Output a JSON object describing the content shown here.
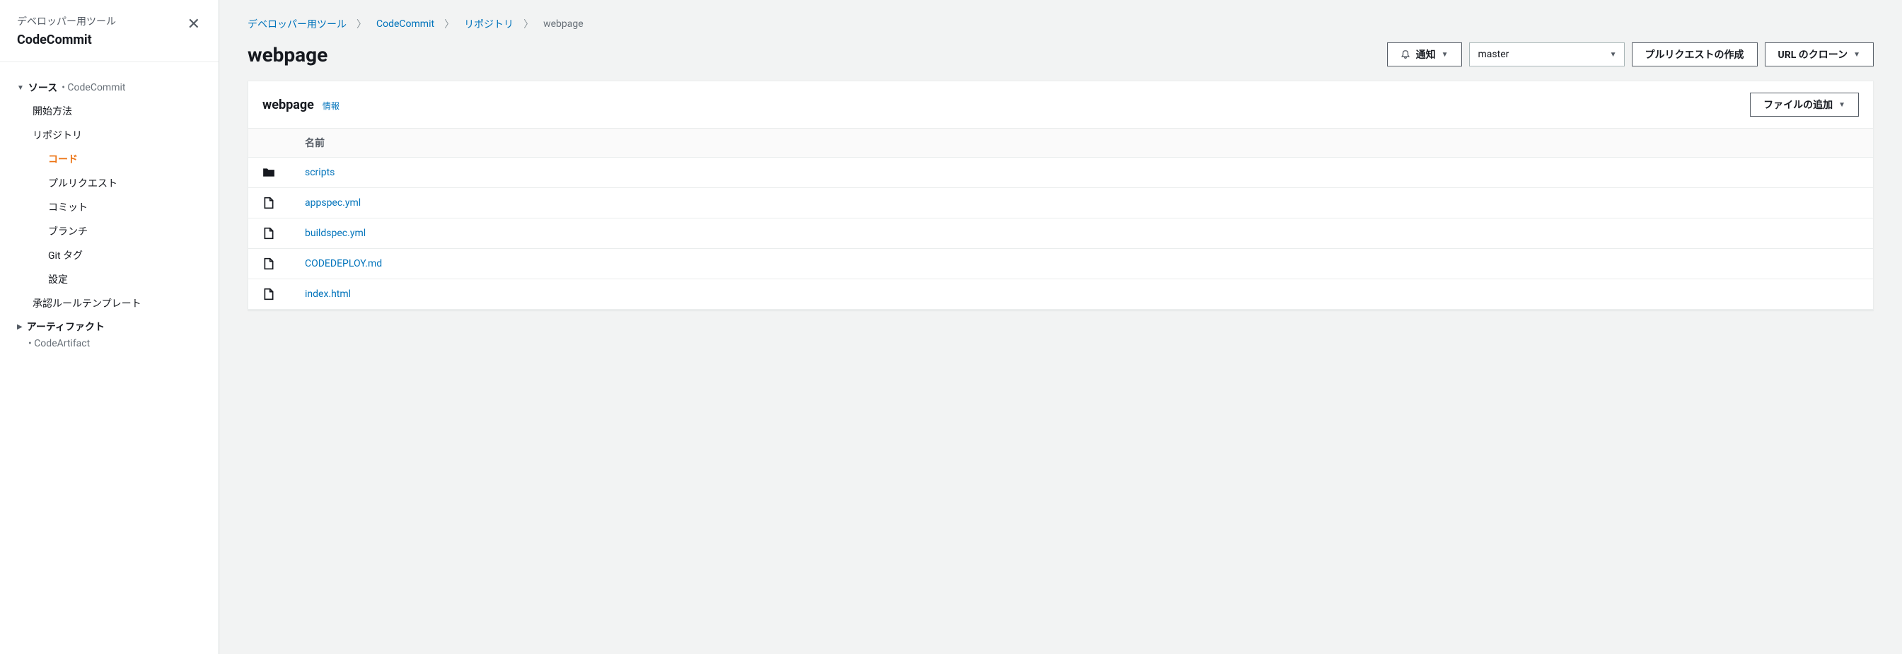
{
  "sidebar": {
    "subtitle": "デベロッパー用ツール",
    "title": "CodeCommit",
    "sections": [
      {
        "label": "ソース",
        "suffix": "CodeCommit",
        "expanded": true,
        "items": [
          {
            "label": "開始方法",
            "active": false,
            "sub": false
          },
          {
            "label": "リポジトリ",
            "active": false,
            "sub": false
          },
          {
            "label": "コード",
            "active": true,
            "sub": true
          },
          {
            "label": "プルリクエスト",
            "active": false,
            "sub": true
          },
          {
            "label": "コミット",
            "active": false,
            "sub": true
          },
          {
            "label": "ブランチ",
            "active": false,
            "sub": true
          },
          {
            "label": "Git タグ",
            "active": false,
            "sub": true
          },
          {
            "label": "設定",
            "active": false,
            "sub": true
          },
          {
            "label": "承認ルールテンプレート",
            "active": false,
            "sub": false
          }
        ]
      },
      {
        "label": "アーティファクト",
        "suffix": "CodeArtifact",
        "expanded": false,
        "items": []
      }
    ]
  },
  "breadcrumb": [
    {
      "label": "デベロッパー用ツール",
      "link": true
    },
    {
      "label": "CodeCommit",
      "link": true
    },
    {
      "label": "リポジトリ",
      "link": true
    },
    {
      "label": "webpage",
      "link": false
    }
  ],
  "page": {
    "title": "webpage"
  },
  "actions": {
    "notify": "通知",
    "branch_selected": "master",
    "create_pr": "プルリクエストの作成",
    "clone_url": "URL のクローン"
  },
  "card": {
    "title": "webpage",
    "info": "情報",
    "add_file": "ファイルの追加"
  },
  "table": {
    "header_name": "名前",
    "rows": [
      {
        "name": "scripts",
        "type": "folder"
      },
      {
        "name": "appspec.yml",
        "type": "file"
      },
      {
        "name": "buildspec.yml",
        "type": "file"
      },
      {
        "name": "CODEDEPLOY.md",
        "type": "file"
      },
      {
        "name": "index.html",
        "type": "file"
      }
    ]
  }
}
